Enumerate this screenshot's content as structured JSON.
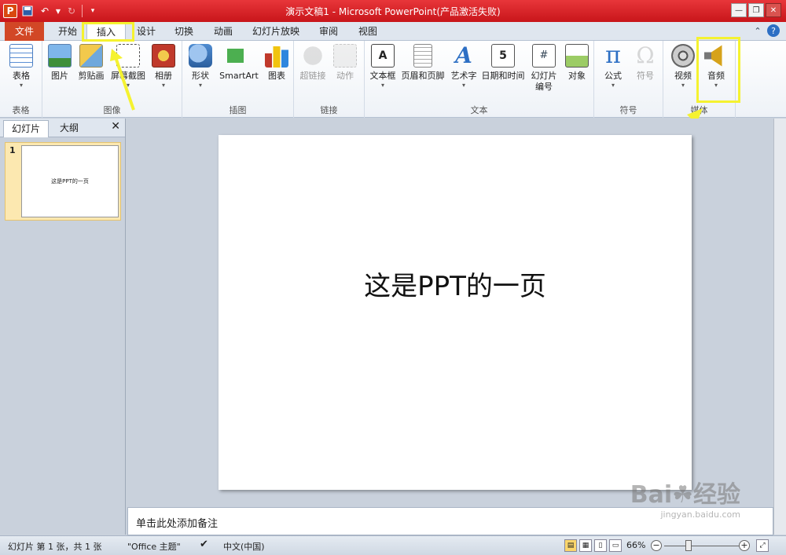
{
  "window": {
    "title": "演示文稿1 - Microsoft PowerPoint(产品激活失败)",
    "qat_logo": "P"
  },
  "tabs": {
    "file": "文件",
    "home": "开始",
    "insert": "插入",
    "design": "设计",
    "transitions": "切换",
    "animations": "动画",
    "slideshow": "幻灯片放映",
    "review": "审阅",
    "view": "视图"
  },
  "ribbon": {
    "groups": {
      "tables": "表格",
      "images": "图像",
      "illustrations": "插图",
      "links": "链接",
      "text": "文本",
      "symbols": "符号",
      "media": "媒体"
    },
    "buttons": {
      "table": "表格",
      "picture": "图片",
      "clipart": "剪贴画",
      "screenshot": "屏幕截图",
      "album": "相册",
      "shapes": "形状",
      "smartart": "SmartArt",
      "chart": "图表",
      "hyperlink": "超链接",
      "action": "动作",
      "textbox": "文本框",
      "headerfooter": "页眉和页脚",
      "wordart": "艺术字",
      "datetime": "日期和时间",
      "slidenum_1": "幻灯片",
      "slidenum_2": "编号",
      "object": "对象",
      "equation": "公式",
      "symbol": "符号",
      "video": "视频",
      "audio": "音频"
    },
    "icon_glyphs": {
      "textbox": "A",
      "wordart": "A",
      "datetime": "5",
      "slidenum": "#",
      "equation": "π",
      "symbol": "Ω"
    }
  },
  "left_panel": {
    "tab_slides": "幻灯片",
    "tab_outline": "大纲",
    "slide_number": "1",
    "thumb_text": "这是PPT的一页"
  },
  "slide": {
    "text": "这是PPT的一页"
  },
  "notes": {
    "placeholder": "单击此处添加备注"
  },
  "watermark": {
    "brand": "Bai☘经验",
    "url": "jingyan.baidu.com"
  },
  "status": {
    "slide_info": "幻灯片 第 1 张，共 1 张",
    "theme": "\"Office 主题\"",
    "language": "中文(中国)",
    "zoom": "66%"
  },
  "colors": {
    "accent_red": "#c8151a",
    "file_tab": "#d24726",
    "highlight": "#f5f230"
  }
}
